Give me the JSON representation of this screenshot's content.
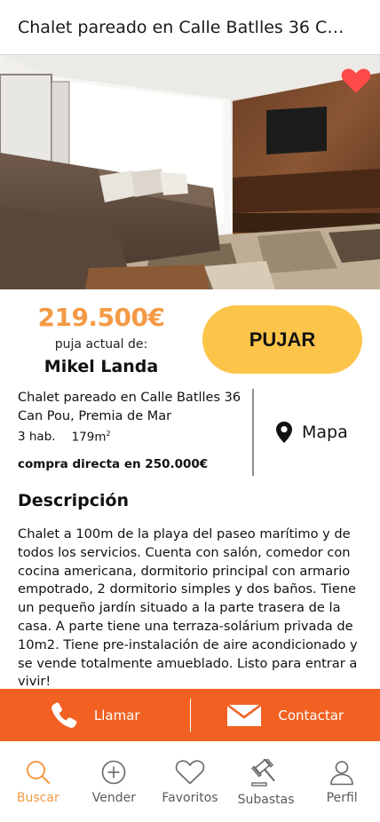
{
  "header": {
    "title": "Chalet pareado en Calle Batlles 36 Can Pou, Premia de Mar"
  },
  "listing": {
    "price": "219.500€",
    "bid_label": "puja actual de:",
    "bidder": "Mikel Landa",
    "bid_button": "PUJAR",
    "address": "Chalet pareado en Calle Batlles 36 Can Pou, Premia de Mar",
    "rooms": "3 hab.",
    "area": "179m",
    "area_unit_sup": "2",
    "direct_buy": "compra directa en 250.000€",
    "map_label": "Mapa"
  },
  "description": {
    "title": "Descripción",
    "text": "Chalet a 100m de la playa del paseo marítimo y de todos los servicios. Cuenta con salón, comedor con cocina americana, dormitorio principal con armario empotrado, 2 dormitorio simples y dos baños. Tiene un pequeño jardín situado a la parte trasera de la casa. A parte tiene una terraza-solárium privada de 10m2. Tiene pre-instalación de aire acondicionado y se vende totalmente amueblado. Listo para entrar a vivir!"
  },
  "actions": {
    "call": "Llamar",
    "contact": "Contactar"
  },
  "tabs": [
    {
      "label": "Buscar",
      "icon": "search-icon"
    },
    {
      "label": "Vender",
      "icon": "plus-circle-icon"
    },
    {
      "label": "Favoritos",
      "icon": "heart-icon"
    },
    {
      "label": "Subastas",
      "icon": "gavel-icon"
    },
    {
      "label": "Perfil",
      "icon": "user-icon"
    }
  ],
  "colors": {
    "accent": "#f26122",
    "price": "#f49a45",
    "bid_button": "#fcc54a",
    "favorite": "#ff4a4a"
  }
}
